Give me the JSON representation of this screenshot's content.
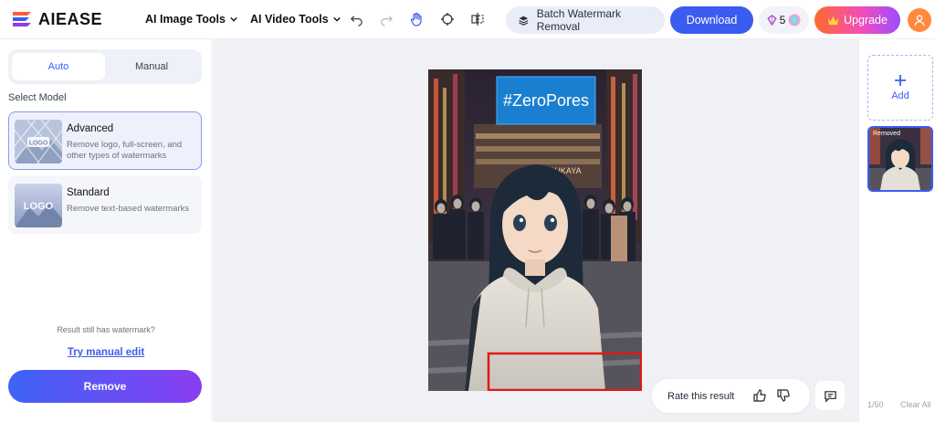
{
  "header": {
    "brand": "AIEASE",
    "nav": [
      {
        "label": "AI Image Tools"
      },
      {
        "label": "AI Video Tools"
      }
    ],
    "tools": [
      "undo-icon",
      "redo-icon",
      "hand-icon",
      "crosshair-icon",
      "compare-icon"
    ],
    "batch_label": "Batch Watermark Removal",
    "download_label": "Download",
    "credits": "5",
    "upgrade_label": "Upgrade",
    "accent_color": "#3b5cf0"
  },
  "left": {
    "tabs": [
      {
        "label": "Auto",
        "active": true
      },
      {
        "label": "Manual",
        "active": false
      }
    ],
    "select_model_label": "Select Model",
    "models": [
      {
        "title": "Advanced",
        "description": "Remove logo, full-screen, and other types of watermarks",
        "selected": true,
        "thumb_text": "LOGO"
      },
      {
        "title": "Standard",
        "description": "Remove text-based watermarks",
        "selected": false,
        "thumb_text": "LOGO"
      }
    ],
    "still_watermark_text": "Result still has watermark?",
    "manual_edit_link": "Try manual edit",
    "remove_label": "Remove"
  },
  "canvas": {
    "sign_text": "#ZeroPores",
    "store_text": "SUKAYA",
    "rate_label": "Rate this result"
  },
  "right": {
    "add_label": "Add",
    "thumb_tag": "Removed",
    "count": "1/50",
    "clear_label": "Clear All"
  }
}
